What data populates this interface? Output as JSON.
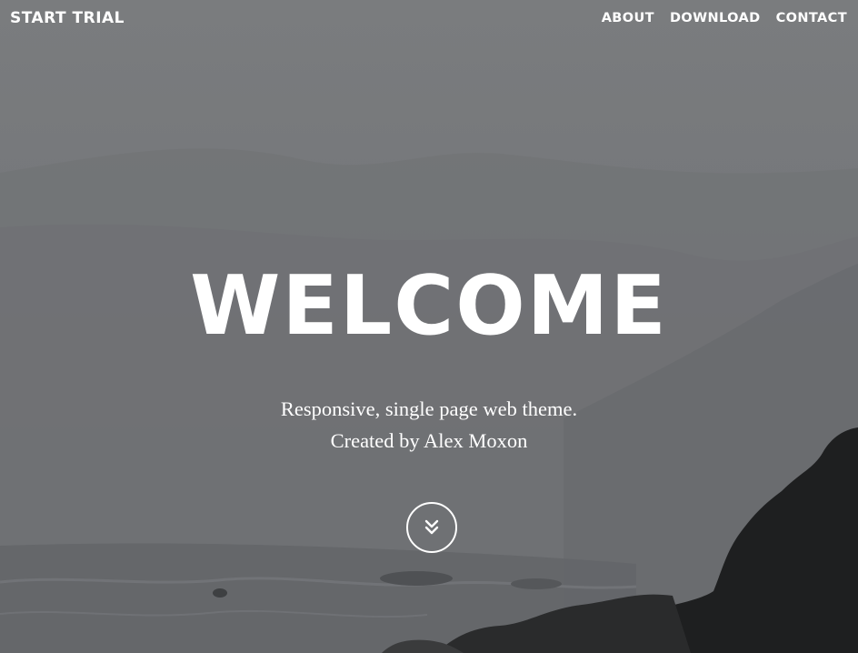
{
  "navbar": {
    "brand": "START TRIAL",
    "links": [
      "ABOUT",
      "DOWNLOAD",
      "CONTACT"
    ]
  },
  "hero": {
    "heading": "WELCOME",
    "tagline_line1": "Responsive, single page web theme.",
    "tagline_line2": "Created by Alex Moxon",
    "scroll_icon": "double-chevron-down-icon"
  },
  "colors": {
    "text": "#ffffff",
    "overlay": "#76787b",
    "rocks": "#1e1f20"
  }
}
